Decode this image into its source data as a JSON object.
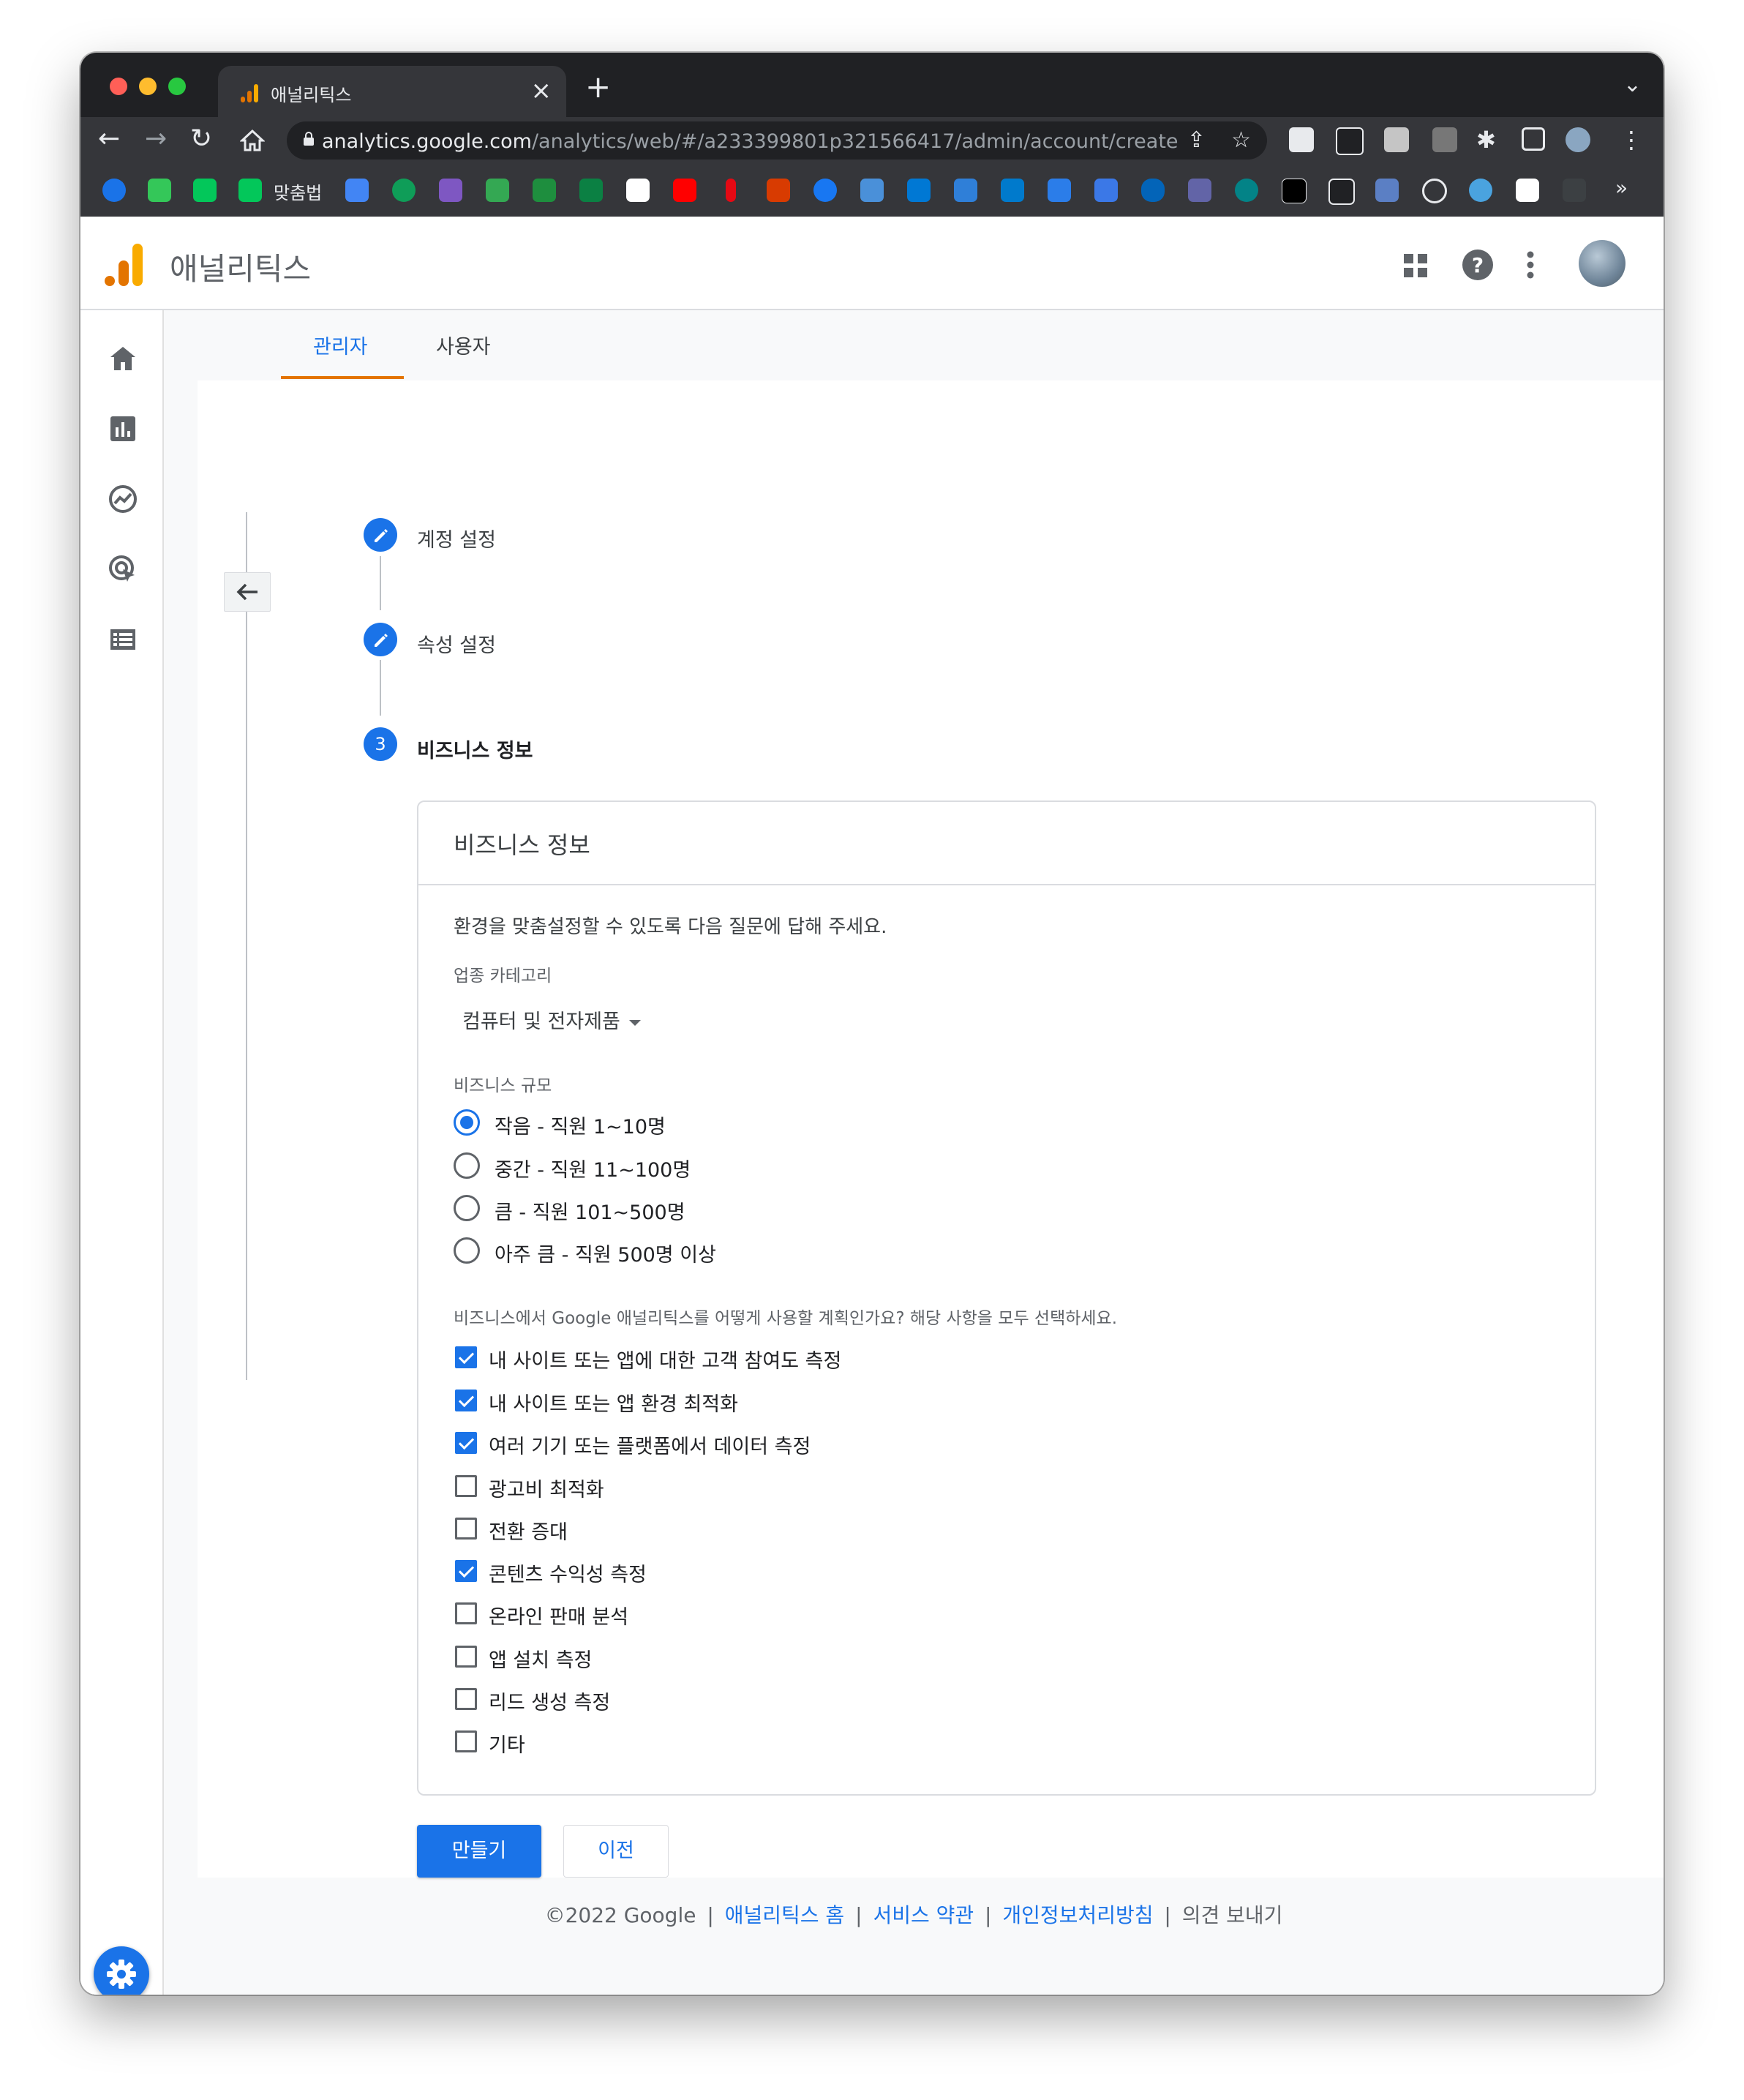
{
  "browser": {
    "tab_title": "애널리틱스",
    "url_host": "analytics.google.com",
    "url_path": "/analytics/web/#/a233399801p321566417/admin/account/create",
    "bookmark_label": "맞춤법",
    "overflow": "»",
    "colors": {
      "frame": "#202124",
      "toolbar": "#35363a"
    }
  },
  "app": {
    "title": "애널리틱스",
    "accent": "#1a73e8",
    "tab_accent": "#e37400"
  },
  "admin_tabs": [
    {
      "label": "관리자",
      "active": true
    },
    {
      "label": "사용자",
      "active": false
    }
  ],
  "steps": [
    {
      "number": "",
      "label": "계정 설정",
      "state": "completed"
    },
    {
      "number": "",
      "label": "속성 설정",
      "state": "completed"
    },
    {
      "number": "3",
      "label": "비즈니스 정보",
      "state": "current"
    }
  ],
  "card": {
    "title": "비즈니스 정보",
    "intro": "환경을 맞춤설정할 수 있도록 다음 질문에 답해 주세요.",
    "industry_label": "업종 카테고리",
    "industry_value": "컴퓨터 및 전자제품",
    "size_label": "비즈니스 규모",
    "size_options": [
      {
        "label": "작음 - 직원 1~10명",
        "selected": true
      },
      {
        "label": "중간 - 직원 11~100명",
        "selected": false
      },
      {
        "label": "큼 - 직원 101~500명",
        "selected": false
      },
      {
        "label": "아주 큼 - 직원 500명 이상",
        "selected": false
      }
    ],
    "usage_label": "비즈니스에서 Google 애널리틱스를 어떻게 사용할 계획인가요? 해당 사항을 모두 선택하세요.",
    "usage_options": [
      {
        "label": "내 사이트 또는 앱에 대한 고객 참여도 측정",
        "checked": true
      },
      {
        "label": "내 사이트 또는 앱 환경 최적화",
        "checked": true
      },
      {
        "label": "여러 기기 또는 플랫폼에서 데이터 측정",
        "checked": true
      },
      {
        "label": "광고비 최적화",
        "checked": false
      },
      {
        "label": "전환 증대",
        "checked": false
      },
      {
        "label": "콘텐츠 수익성 측정",
        "checked": true
      },
      {
        "label": "온라인 판매 분석",
        "checked": false
      },
      {
        "label": "앱 설치 측정",
        "checked": false
      },
      {
        "label": "리드 생성 측정",
        "checked": false
      },
      {
        "label": "기타",
        "checked": false
      }
    ]
  },
  "actions": {
    "create": "만들기",
    "previous": "이전"
  },
  "footer": {
    "copyright": "©2022 Google",
    "links": [
      "애널리틱스 홈",
      "서비스 약관",
      "개인정보처리방침"
    ],
    "feedback": "의견 보내기",
    "separator": "|"
  }
}
